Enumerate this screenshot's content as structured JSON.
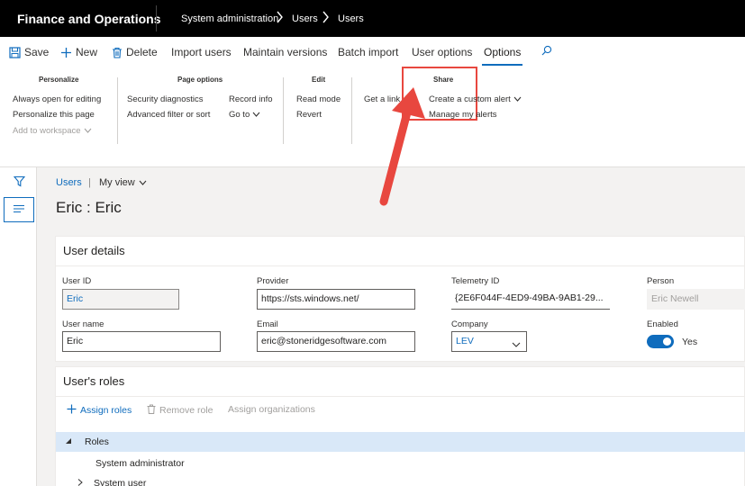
{
  "topbar": {
    "app_title": "Finance and Operations",
    "breadcrumb": [
      "System administration",
      "Users",
      "Users"
    ]
  },
  "actionpane": {
    "tabs": [
      {
        "label": "Save",
        "icon": "save-icon"
      },
      {
        "label": "New",
        "icon": "plus-icon"
      },
      {
        "label": "Delete",
        "icon": "trash-icon"
      },
      {
        "label": "Import users"
      },
      {
        "label": "Maintain versions"
      },
      {
        "label": "Batch import"
      },
      {
        "label": "User options"
      },
      {
        "label": "Options",
        "active": true
      }
    ],
    "search_icon": "search-icon",
    "groups": {
      "personalize": {
        "title": "Personalize",
        "items": [
          "Always open for editing",
          "Personalize this page",
          "Add to workspace"
        ]
      },
      "page_options": {
        "title": "Page options",
        "items": [
          "Security diagnostics",
          "Advanced filter or sort",
          "Record info",
          "Go to"
        ]
      },
      "edit": {
        "title": "Edit",
        "items": [
          "Read mode",
          "Revert"
        ]
      },
      "share": {
        "title": "Share",
        "items": [
          "Get a link",
          "Create a custom alert",
          "Manage my alerts"
        ]
      }
    },
    "highlight_color": "#e8473f",
    "accent_color": "#0f6cbd"
  },
  "page": {
    "breadcrumb_link": "Users",
    "view_name": "My view",
    "title": "Eric : Eric"
  },
  "user_details": {
    "header": "User details",
    "fields": {
      "user_id": {
        "label": "User ID",
        "value": "Eric"
      },
      "provider": {
        "label": "Provider",
        "value": "https://sts.windows.net/"
      },
      "telemetry_id": {
        "label": "Telemetry ID",
        "value": "{2E6F044F-4ED9-49BA-9AB1-29..."
      },
      "person": {
        "label": "Person",
        "value": "Eric Newell"
      },
      "user_name": {
        "label": "User name",
        "value": "Eric"
      },
      "email": {
        "label": "Email",
        "value": "eric@stoneridgesoftware.com"
      },
      "company": {
        "label": "Company",
        "value": "LEV"
      },
      "enabled": {
        "label": "Enabled",
        "value": "Yes",
        "on": true
      }
    }
  },
  "roles": {
    "header": "User's roles",
    "actions": [
      "Assign roles",
      "Remove role",
      "Assign organizations"
    ],
    "tree": [
      "Roles",
      "System administrator",
      "System user"
    ]
  }
}
